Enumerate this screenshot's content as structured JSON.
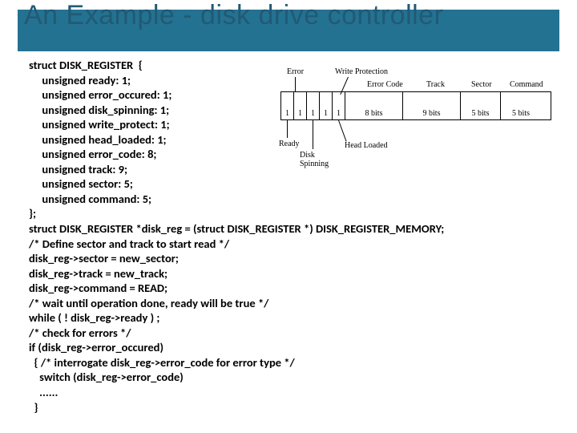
{
  "title": "An Example - disk drive controller",
  "diagram": {
    "top": {
      "error": "Error",
      "wp": "Write Protection",
      "ec": "Error Code",
      "track": "Track",
      "sector": "Sector",
      "cmd": "Command"
    },
    "cells": {
      "b1": "1",
      "b2": "1",
      "b3": "1",
      "b4": "1",
      "b5": "1",
      "ec": "8 bits",
      "track": "9 bits",
      "sector": "5 bits",
      "cmd": "5 bits"
    },
    "bottom": {
      "ready": "Ready",
      "disk": "Disk\nSpinning",
      "head": "Head Loaded"
    }
  },
  "code": "struct DISK_REGISTER  {\n     unsigned ready: 1;\n     unsigned error_occured: 1;\n     unsigned disk_spinning: 1;\n     unsigned write_protect: 1;\n     unsigned head_loaded: 1;\n     unsigned error_code: 8;\n     unsigned track: 9;\n     unsigned sector: 5;\n     unsigned command: 5;\n};\nstruct DISK_REGISTER *disk_reg = (struct DISK_REGISTER *) DISK_REGISTER_MEMORY;\n/* Define sector and track to start read */\ndisk_reg->sector = new_sector;\ndisk_reg->track = new_track;\ndisk_reg->command = READ;\n/* wait until operation done, ready will be true */\nwhile ( ! disk_reg->ready ) ;\n/* check for errors */\nif (disk_reg->error_occured)\n  { /* interrogate disk_reg->error_code for error type */\n    switch (disk_reg->error_code)\n    ......\n  }"
}
